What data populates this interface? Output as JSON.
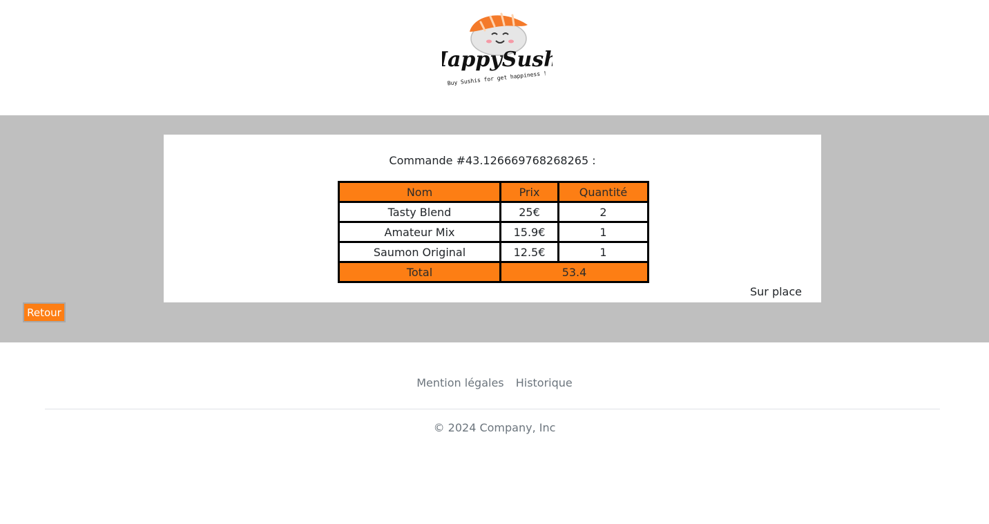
{
  "brand": {
    "name_part1": "Happy",
    "name_part2": "Sushi",
    "tagline": "Buy Sushis for get happiness !",
    "colors": {
      "orange": "#fd7e14",
      "salmon": "#f47a2a"
    }
  },
  "order": {
    "title": "Commande #43.126669768268265 :",
    "columns": [
      "Nom",
      "Prix",
      "Quantité"
    ],
    "rows": [
      {
        "nom": "Tasty Blend",
        "prix": "25€",
        "quantite": "2"
      },
      {
        "nom": "Amateur Mix",
        "prix": "15.9€",
        "quantite": "1"
      },
      {
        "nom": "Saumon Original",
        "prix": "12.5€",
        "quantite": "1"
      }
    ],
    "total_label": "Total",
    "total_value": "53.4",
    "mode": "Sur place"
  },
  "actions": {
    "back_label": "Retour"
  },
  "footer": {
    "links": [
      "Mention légales",
      "Historique"
    ],
    "copyright": "© 2024 Company, Inc"
  },
  "colors": {
    "accent": "#fd7e14",
    "main_bg": "#bfbfbf",
    "muted_text": "#6c757d"
  }
}
